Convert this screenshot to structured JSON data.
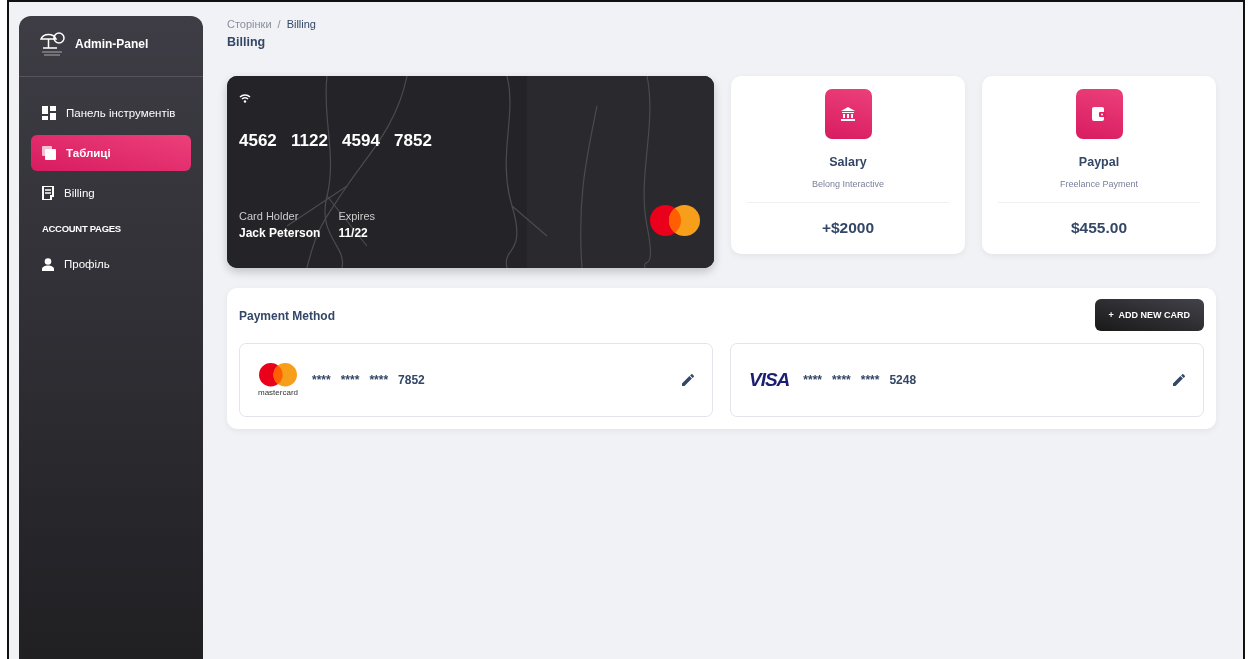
{
  "sidebar": {
    "brand": "Admin-Panel",
    "items": [
      {
        "label": "Панель інструментів",
        "kind": "dashboard",
        "selected": false
      },
      {
        "label": "Таблиці",
        "kind": "tables",
        "selected": true
      },
      {
        "label": "Billing",
        "kind": "receipt",
        "selected": false
      }
    ],
    "section_title": "ACCOUNT PAGES",
    "account_items": [
      {
        "label": "Профіль",
        "kind": "person",
        "selected": false
      }
    ]
  },
  "breadcrumb": {
    "parent": "Сторінки",
    "separator": "/",
    "current": "Billing"
  },
  "page_title": "Billing",
  "credit_card": {
    "number": "4562   1122   4594   7852",
    "holder_label": "Card Holder",
    "holder": "Jack Peterson",
    "expires_label": "Expires",
    "expires": "11/22"
  },
  "info_cards": [
    {
      "kind": "bank",
      "title": "Salary",
      "subtitle": "Belong Interactive",
      "amount": "+$2000"
    },
    {
      "kind": "wallet",
      "title": "Paypal",
      "subtitle": "Freelance Payment",
      "amount": "$455.00"
    }
  ],
  "payment_method": {
    "title": "Payment Method",
    "button": "+  ADD NEW CARD",
    "cards": [
      {
        "kind": "mastercard",
        "brand_label": "mastercard",
        "number": "****   ****   ****   7852"
      },
      {
        "kind": "visa",
        "brand_label": "VISA",
        "number": "****   ****   ****   5248"
      }
    ]
  }
}
